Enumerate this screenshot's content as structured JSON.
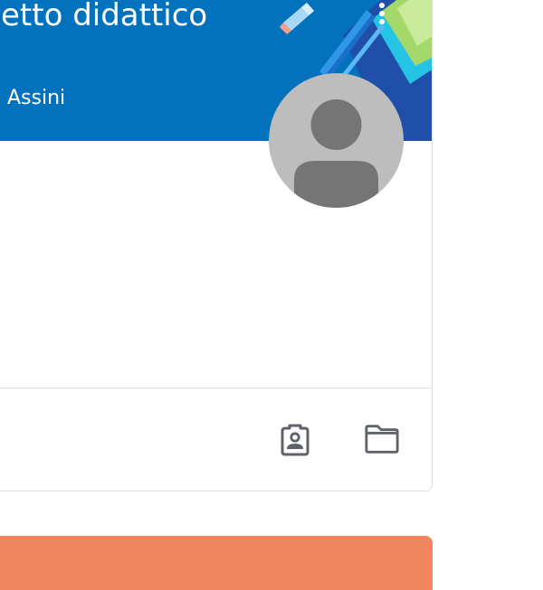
{
  "class_card": {
    "title": "etto didattico",
    "teacher": "Assini",
    "header_color": "#0272bd",
    "avatar_color": "#bdbdbd",
    "icons": {
      "more": "more-vert-icon",
      "profile": "assignment-ind-icon",
      "folder": "folder-icon"
    }
  },
  "next_card": {
    "header_color": "#f2865e"
  }
}
